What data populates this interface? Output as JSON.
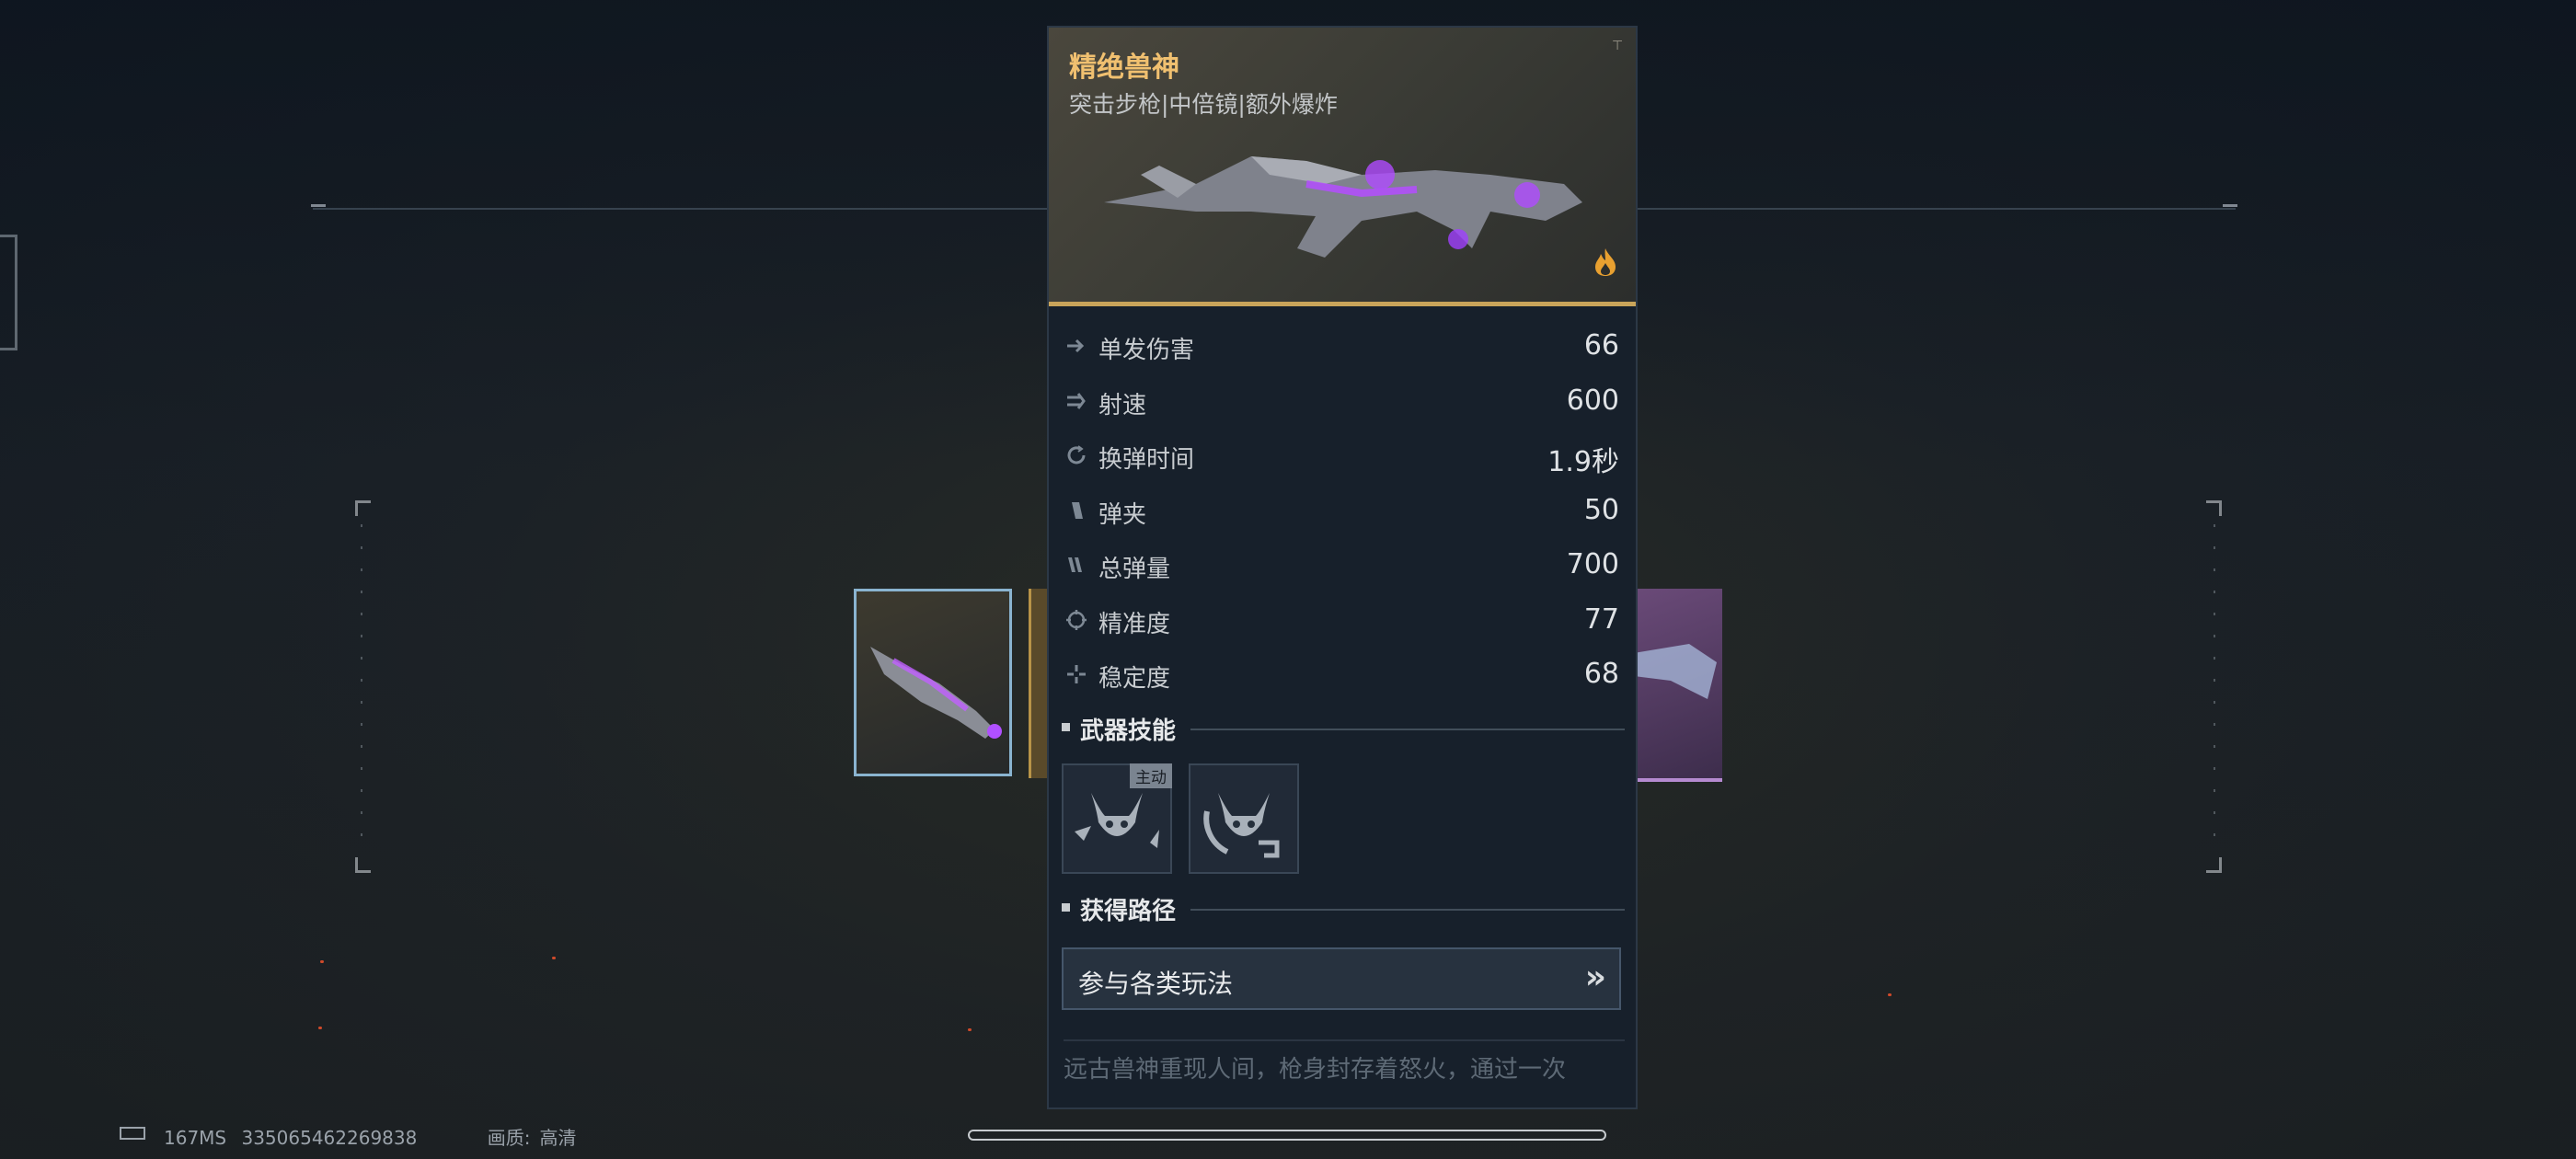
{
  "weapon": {
    "name": "精绝兽神",
    "tags": "突击步枪|中倍镜|额外爆炸"
  },
  "stats": [
    {
      "icon": "damage-icon",
      "label": "单发伤害",
      "value": "66"
    },
    {
      "icon": "fire-rate-icon",
      "label": "射速",
      "value": "600"
    },
    {
      "icon": "reload-icon",
      "label": "换弹时间",
      "value": "1.9秒"
    },
    {
      "icon": "magazine-icon",
      "label": "弹夹",
      "value": "50"
    },
    {
      "icon": "total-ammo-icon",
      "label": "总弹量",
      "value": "700"
    },
    {
      "icon": "accuracy-icon",
      "label": "精准度",
      "value": "77"
    },
    {
      "icon": "stability-icon",
      "label": "稳定度",
      "value": "68"
    }
  ],
  "skills_section": {
    "title": "武器技能",
    "skills": [
      {
        "icon": "beast-skill-active-icon",
        "badge": "主动"
      },
      {
        "icon": "beast-skill-passive-icon",
        "badge": ""
      }
    ]
  },
  "source_section": {
    "title": "获得路径",
    "button_label": "参与各类玩法",
    "button_icon": "double-chevron-right-icon"
  },
  "description": "远古兽神重现人间，枪身封存着怒火，通过一次",
  "status_bar": {
    "ping": "167MS",
    "uid": "335065462269838",
    "quality_label": "画质:",
    "quality_value": "高清"
  },
  "colors": {
    "accent_gold": "#c9a45a",
    "name_color": "#f0c070",
    "weapon_glow": "#a040ff"
  }
}
